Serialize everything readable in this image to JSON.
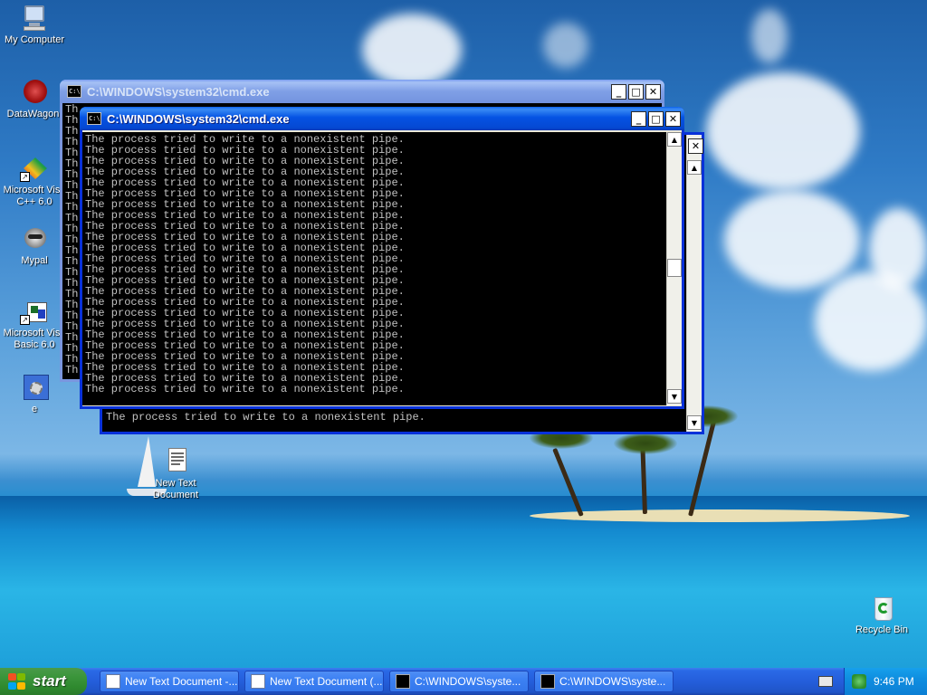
{
  "desktop": {
    "icons": [
      {
        "label": "My Computer",
        "icon": "my-computer-icon"
      },
      {
        "label": "DataWagon.",
        "icon": "datawagon-icon"
      },
      {
        "label": "Microsoft Visu\nC++ 6.0",
        "icon": "visual-cpp-icon"
      },
      {
        "label": "Mypal",
        "icon": "mypal-icon"
      },
      {
        "label": "Microsoft Visu\nBasic 6.0",
        "icon": "visual-basic-icon"
      },
      {
        "label": "e",
        "icon": "settings-shortcut-icon"
      },
      {
        "label": "New Text\nDocument",
        "icon": "text-document-icon"
      },
      {
        "label": "Recycle Bin",
        "icon": "recycle-bin-icon"
      }
    ]
  },
  "windows": {
    "back": {
      "title": "C:\\WINDOWS\\system32\\cmd.exe",
      "line_prefix": "Th"
    },
    "front": {
      "title": "C:\\WINDOWS\\system32\\cmd.exe",
      "line": "The process tried to write to a nonexistent pipe."
    },
    "third": {
      "last_line": "The process tried to write to a nonexistent pipe."
    },
    "controls": {
      "minimize": "_",
      "maximize": "□",
      "close": "✕"
    }
  },
  "taskbar": {
    "start_label": "start",
    "buttons": [
      {
        "label": "New Text Document -...",
        "icon": "notepad-icon"
      },
      {
        "label": "New Text Document (...",
        "icon": "notepad-icon"
      },
      {
        "label": "C:\\WINDOWS\\syste...",
        "icon": "cmd-icon"
      },
      {
        "label": "C:\\WINDOWS\\syste...",
        "icon": "cmd-icon"
      }
    ],
    "clock": "9:46 PM"
  }
}
